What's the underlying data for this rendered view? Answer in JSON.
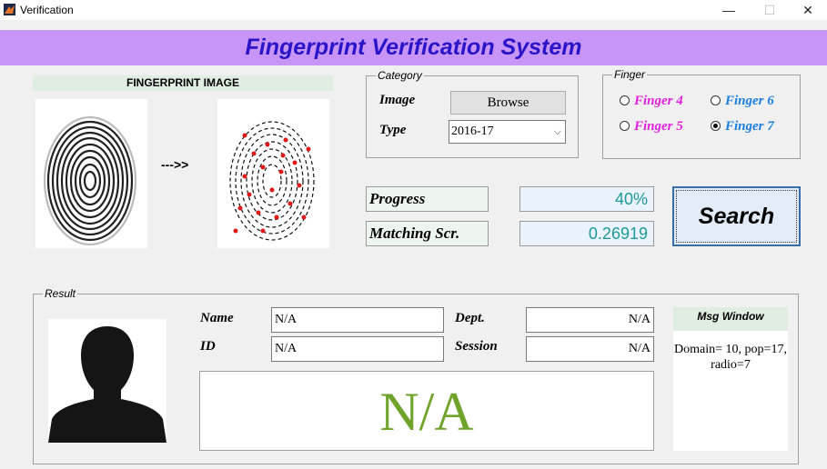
{
  "window": {
    "title": "Verification",
    "min": "—",
    "max": "☐",
    "close": "✕"
  },
  "banner": {
    "title": "Fingerprint Verification System"
  },
  "fingerprint": {
    "header": "FINGERPRINT IMAGE",
    "arrow": "--->>"
  },
  "category": {
    "label": "Category",
    "image_label": "Image",
    "browse_label": "Browse",
    "type_label": "Type",
    "type_value": "2016-17"
  },
  "finger": {
    "label": "Finger",
    "options": [
      {
        "label": "Finger 4",
        "color": "#e020e0",
        "selected": false
      },
      {
        "label": "Finger 6",
        "color": "#1a7fe0",
        "selected": false
      },
      {
        "label": "Finger 5",
        "color": "#e020e0",
        "selected": false
      },
      {
        "label": "Finger 7",
        "color": "#1a7fe0",
        "selected": true
      }
    ]
  },
  "status": {
    "progress_label": "Progress",
    "progress_value": "40%",
    "matching_label": "Matching Scr.",
    "matching_value": "0.26919"
  },
  "search": {
    "label": "Search"
  },
  "result": {
    "label": "Result",
    "name_label": "Name",
    "name_value": "N/A",
    "id_label": "ID",
    "id_value": "N/A",
    "dept_label": "Dept.",
    "dept_value": "N/A",
    "session_label": "Session",
    "session_value": "N/A",
    "big_value": "N/A"
  },
  "msg": {
    "header": "Msg Window",
    "text": "Domain= 10, pop=17, radio=7"
  },
  "colors": {
    "banner": "#c695f7",
    "title_text": "#2a14c8",
    "value_text": "#1e9a9a",
    "big_na": "#6fa32a"
  }
}
